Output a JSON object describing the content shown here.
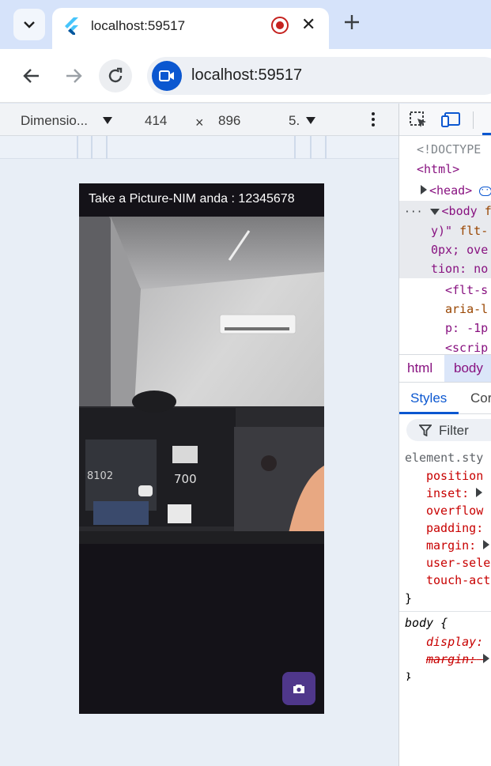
{
  "browser": {
    "tab_title": "localhost:59517",
    "url": "localhost:59517"
  },
  "device_toolbar": {
    "dimensions_label": "Dimensio...",
    "width": "414",
    "times": "×",
    "height": "896",
    "zoom": "5."
  },
  "app": {
    "title": "Take a Picture-NIM anda : 12345678"
  },
  "devtools": {
    "dom": {
      "doctype": "<!DOCTYPE",
      "html_open": "<html>",
      "head": "<head>",
      "body_line1_tag": "<body",
      "body_line1_attr": " fl",
      "body_line2_attr": "y)\"",
      "body_line2_rest": " flt-",
      "body_line3": "0px; ove",
      "body_line4": "tion: no",
      "flt_line1": "<flt-s",
      "flt_line2": "aria-l",
      "flt_line3": "p: -1p",
      "script_line": "<scrip"
    },
    "breadcrumbs": [
      "html",
      "body"
    ],
    "sub_tabs": [
      "Styles",
      "Cor"
    ],
    "filter_placeholder": "Filter",
    "styles": {
      "element_selector": "element.sty",
      "element_props": [
        "position",
        "inset:",
        "overflow",
        "padding:",
        "margin:",
        "user-sele",
        "touch-act"
      ],
      "close_brace": "}",
      "body_selector": "body {",
      "body_props": [
        "display:",
        "margin:"
      ]
    }
  }
}
